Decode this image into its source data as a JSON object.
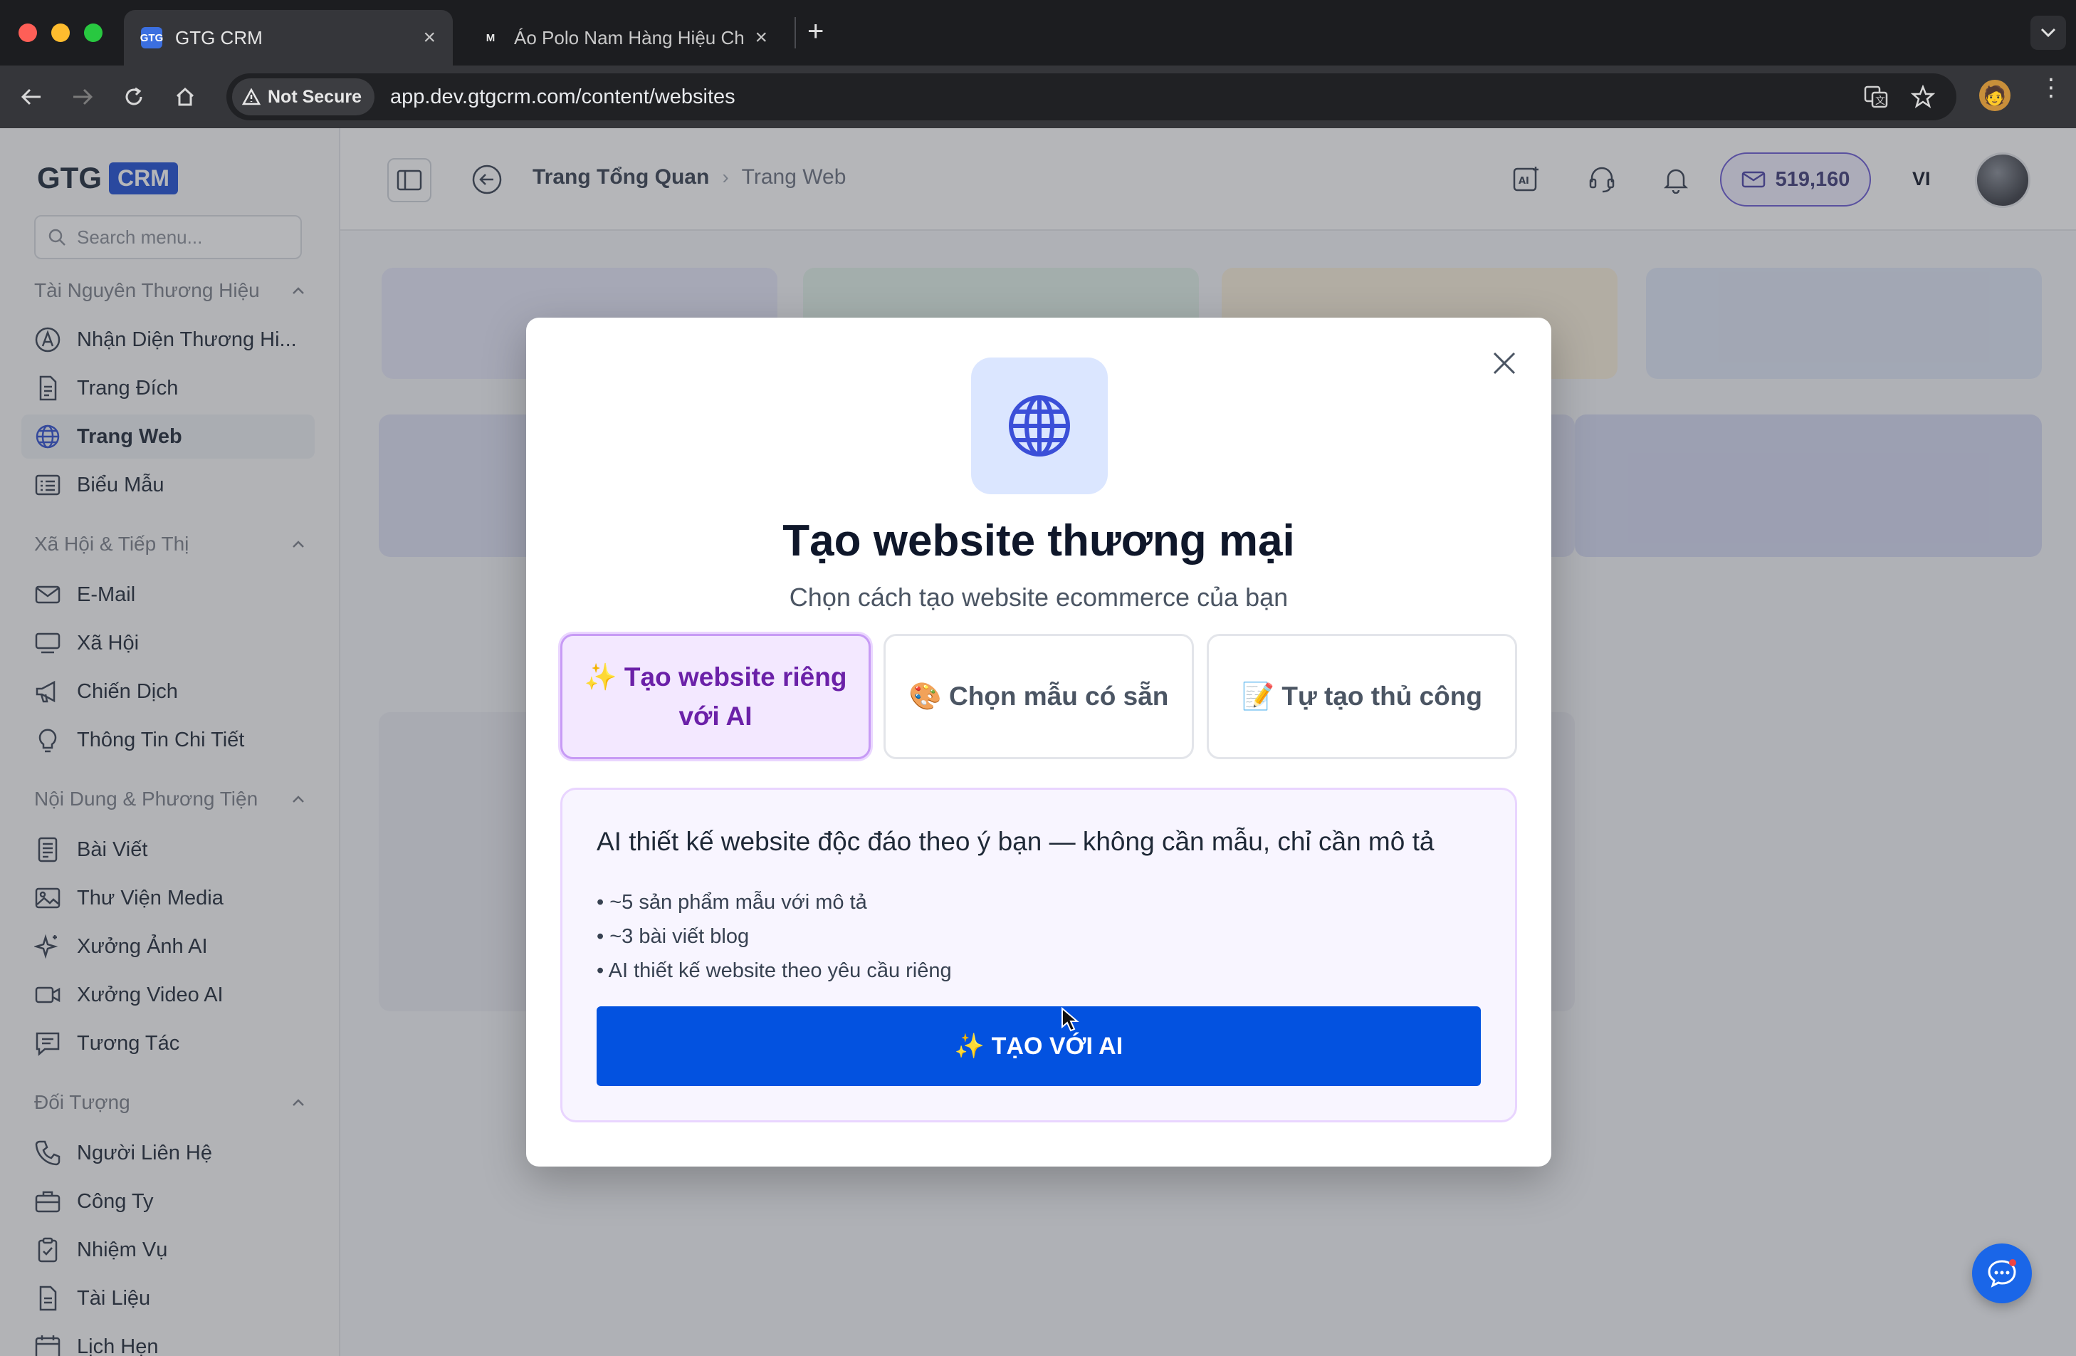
{
  "browser": {
    "tabs": [
      {
        "title": "GTG CRM",
        "favicon": "GTG"
      },
      {
        "title": "Áo Polo Nam Hàng Hiệu Chính",
        "favicon": "M"
      }
    ],
    "security_label": "Not Secure",
    "url": "app.dev.gtgcrm.com/content/websites"
  },
  "sidebar": {
    "logo_text": "GTG",
    "logo_badge": "CRM",
    "search_placeholder": "Search menu...",
    "sections": [
      {
        "title": "Tài Nguyên Thương Hiệu",
        "items": [
          {
            "label": "Nhận Diện Thương Hi...",
            "icon": "brand-icon"
          },
          {
            "label": "Trang Đích",
            "icon": "page-icon"
          },
          {
            "label": "Trang Web",
            "icon": "globe-icon"
          },
          {
            "label": "Biểu Mẫu",
            "icon": "form-icon"
          }
        ]
      },
      {
        "title": "Xã Hội & Tiếp Thị",
        "items": [
          {
            "label": "E-Mail",
            "icon": "mail-icon"
          },
          {
            "label": "Xã Hội",
            "icon": "monitor-icon"
          },
          {
            "label": "Chiến Dịch",
            "icon": "megaphone-icon"
          },
          {
            "label": "Thông Tin Chi Tiết",
            "icon": "lightbulb-icon"
          }
        ]
      },
      {
        "title": "Nội Dung & Phương Tiện",
        "items": [
          {
            "label": "Bài Viết",
            "icon": "article-icon"
          },
          {
            "label": "Thư Viện Media",
            "icon": "image-icon"
          },
          {
            "label": "Xưởng Ảnh AI",
            "icon": "sparkles-icon"
          },
          {
            "label": "Xưởng Video AI",
            "icon": "video-icon"
          },
          {
            "label": "Tương Tác",
            "icon": "chat-icon"
          }
        ]
      },
      {
        "title": "Đối Tượng",
        "items": [
          {
            "label": "Người Liên Hệ",
            "icon": "phone-icon"
          },
          {
            "label": "Công Ty",
            "icon": "briefcase-icon"
          },
          {
            "label": "Nhiệm Vụ",
            "icon": "clipboard-icon"
          },
          {
            "label": "Tài Liệu",
            "icon": "document-icon"
          },
          {
            "label": "Lịch Hẹn",
            "icon": "calendar-icon"
          }
        ]
      }
    ],
    "active_item": "Trang Web"
  },
  "topbar": {
    "breadcrumb": [
      "Trang Tổng Quan",
      "Trang Web"
    ],
    "credits": "519,160",
    "language": "VI"
  },
  "modal": {
    "title": "Tạo website thương mại",
    "subtitle": "Chọn cách tạo website ecommerce của bạn",
    "options": [
      {
        "label_line1": "✨ Tạo website riêng",
        "label_line2": "với AI",
        "selected": true
      },
      {
        "label": "🎨 Chọn mẫu có sẵn",
        "selected": false
      },
      {
        "label": "📝 Tự tạo thủ công",
        "selected": false
      }
    ],
    "panel": {
      "headline": "AI thiết kế website độc đáo theo ý bạn — không cần mẫu, chỉ cần mô tả",
      "bullets": [
        "• ~5 sản phẩm mẫu với mô tả",
        "• ~3 bài viết blog",
        "• AI thiết kế website theo yêu cầu riêng"
      ],
      "cta": "✨ TẠO VỚI AI"
    }
  },
  "colors": {
    "accent": "#0352e0",
    "selected_option_bg": "#f3e8ff",
    "selected_option_text": "#6b21a8",
    "logo_badge": "#1f4fd6"
  }
}
